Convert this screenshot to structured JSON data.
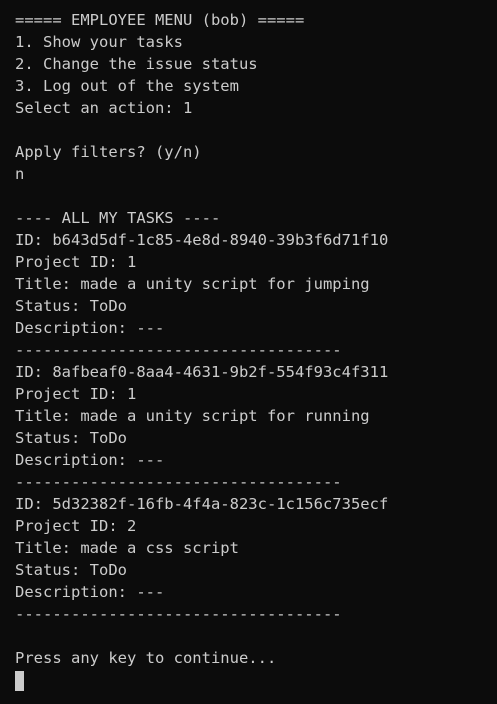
{
  "terminal": {
    "lines": [
      "===== EMPLOYEE MENU (bob) =====",
      "1. Show your tasks",
      "2. Change the issue status",
      "3. Log out of the system",
      "Select an action: 1",
      "",
      "Apply filters? (y/n)",
      "n",
      "",
      "---- ALL MY TASKS ----",
      "ID: b643d5df-1c85-4e8d-8940-39b3f6d71f10",
      "Project ID: 1",
      "Title: made a unity script for jumping",
      "Status: ToDo",
      "Description: ---",
      "-----------------------------------",
      "ID: 8afbeaf0-8aa4-4631-9b2f-554f93c4f311",
      "Project ID: 1",
      "Title: made a unity script for running",
      "Status: ToDo",
      "Description: ---",
      "-----------------------------------",
      "ID: 5d32382f-16fb-4f4a-823c-1c156c735ecf",
      "Project ID: 2",
      "Title: made a css script",
      "Status: ToDo",
      "Description: ---",
      "-----------------------------------",
      "",
      "Press any key to continue..."
    ]
  }
}
